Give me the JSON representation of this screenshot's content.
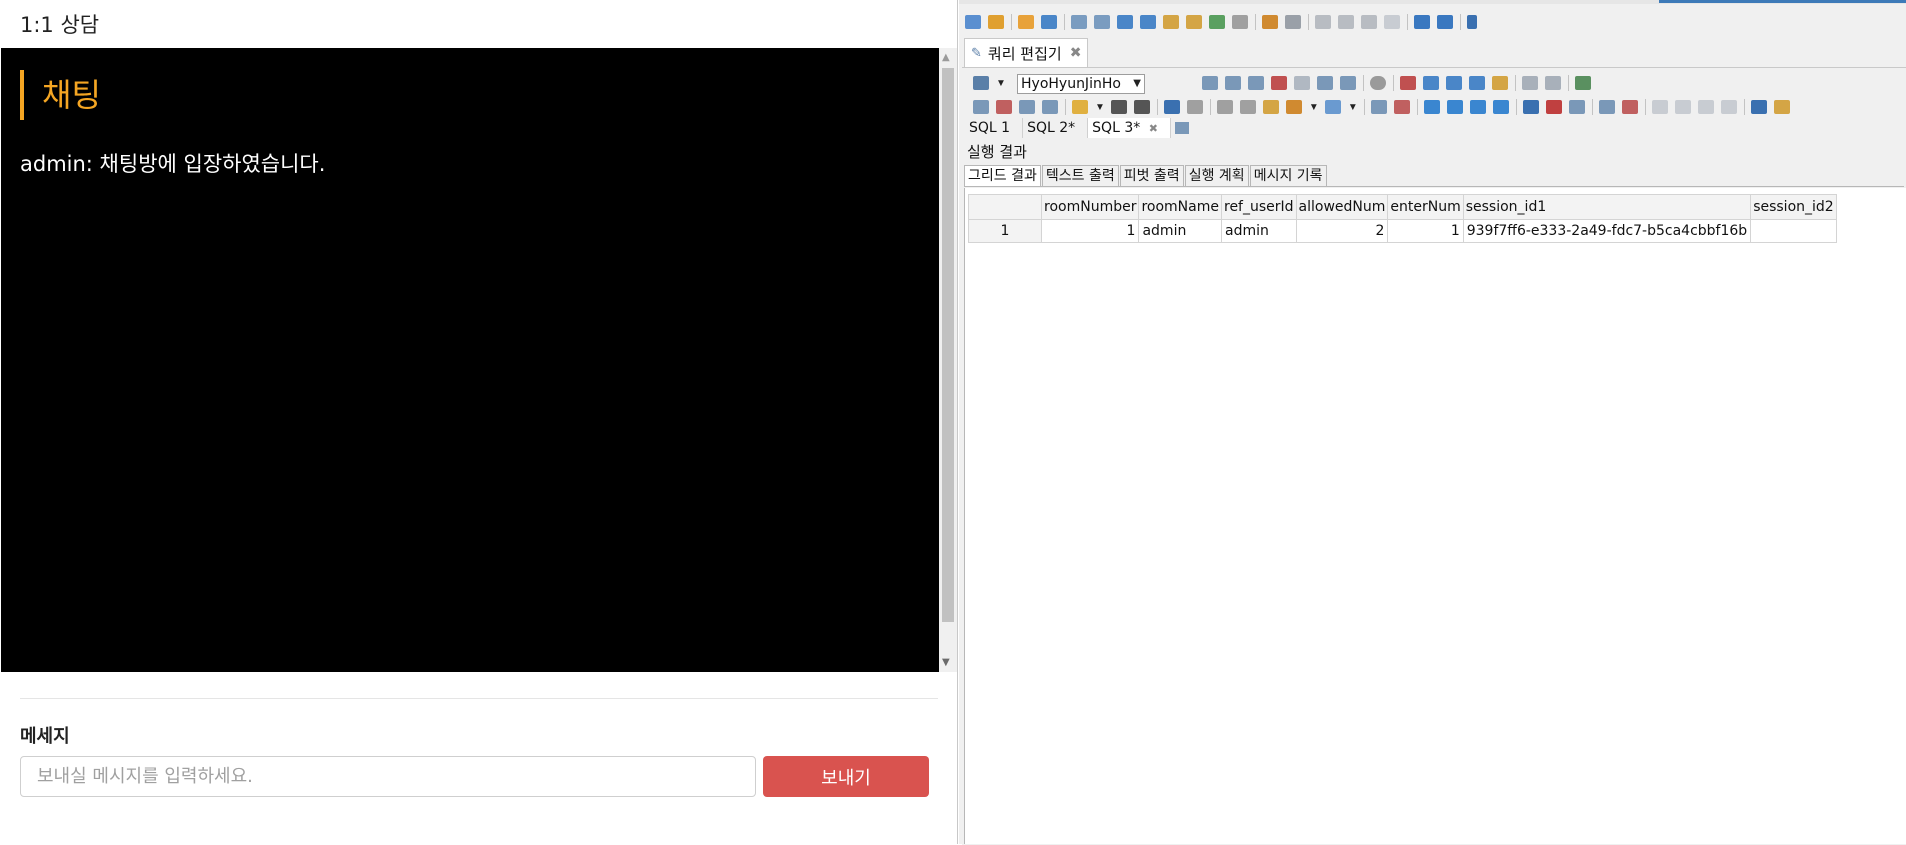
{
  "chat": {
    "window_title": "1:1 상담",
    "heading": "채팅",
    "messages": [
      "admin: 채팅방에 입장하였습니다."
    ],
    "message_label": "메세지",
    "input_placeholder": "보내실 메시지를 입력하세요.",
    "send_label": "보내기",
    "accent_color": "#f5a623",
    "send_color": "#d9534f"
  },
  "sql": {
    "editor_tab": "쿼리 편집기",
    "connection": "HyoHyunJinHo",
    "sql_tabs": [
      "SQL 1",
      "SQL 2*",
      "SQL 3*"
    ],
    "result_label": "실행 결과",
    "result_tabs": [
      "그리드 결과",
      "텍스트 출력",
      "피벗 출력",
      "실행 계획",
      "메시지 기록"
    ],
    "columns": [
      "roomNumber",
      "roomName",
      "ref_userId",
      "allowedNum",
      "enterNum",
      "session_id1",
      "session_id2"
    ],
    "rows": [
      [
        "1",
        "1",
        "admin",
        "admin",
        "2",
        "1",
        "939f7ff6-e333-2a49-fdc7-b5ca4cbbf16b",
        ""
      ]
    ]
  }
}
